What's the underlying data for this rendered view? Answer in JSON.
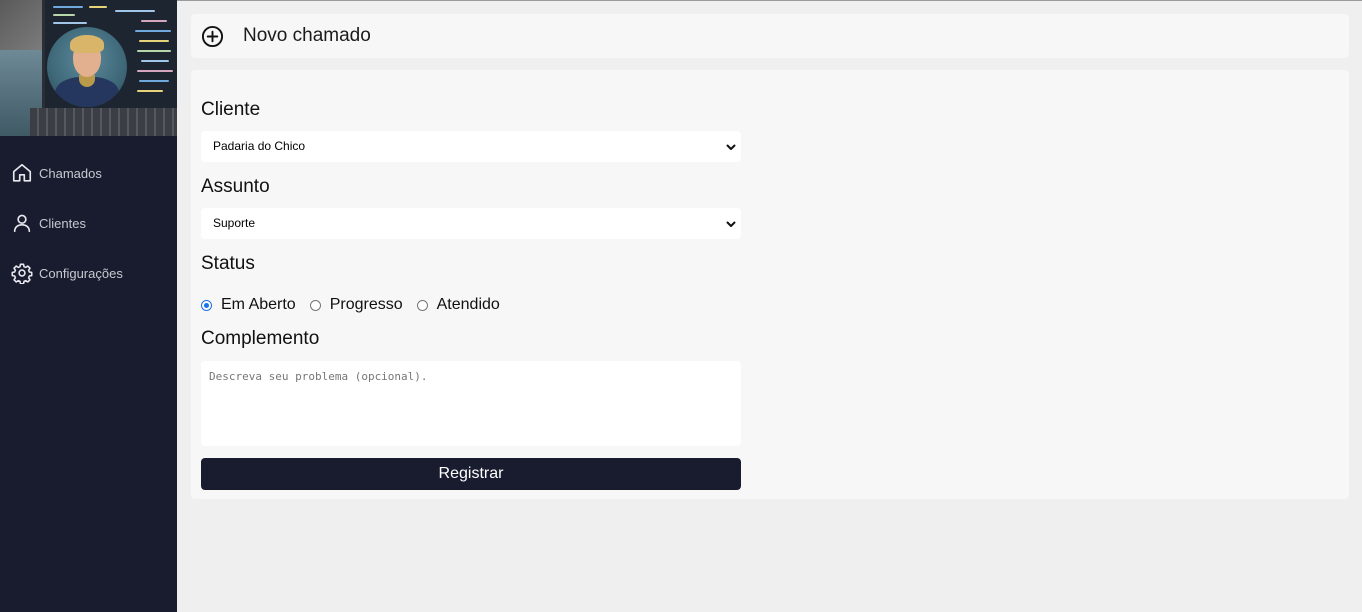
{
  "sidebar": {
    "items": [
      {
        "label": "Chamados",
        "icon": "home-icon"
      },
      {
        "label": "Clientes",
        "icon": "user-icon"
      },
      {
        "label": "Configurações",
        "icon": "gear-icon"
      }
    ]
  },
  "header": {
    "icon": "plus-circle-icon",
    "title": "Novo chamado"
  },
  "form": {
    "cliente_label": "Cliente",
    "cliente_value": "Padaria do Chico",
    "assunto_label": "Assunto",
    "assunto_value": "Suporte",
    "status_label": "Status",
    "status_options": [
      "Em Aberto",
      "Progresso",
      "Atendido"
    ],
    "status_selected": "Em Aberto",
    "complemento_label": "Complemento",
    "complemento_placeholder": "Descreva seu problema (opcional).",
    "submit_label": "Registrar"
  },
  "colors": {
    "sidebar_bg": "#181c2e",
    "page_bg": "#efefef",
    "card_bg": "#f7f7f7",
    "button_bg": "#181c2e",
    "radio_accent": "#1a73e8"
  }
}
